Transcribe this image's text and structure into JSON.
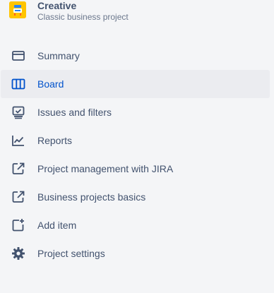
{
  "project": {
    "name": "Creative",
    "type": "Classic business project",
    "avatar_icon": "project-avatar-icon",
    "avatar_color": "#ffc400"
  },
  "nav": {
    "items": [
      {
        "label": "Summary",
        "icon": "summary-icon",
        "selected": false
      },
      {
        "label": "Board",
        "icon": "board-icon",
        "selected": true
      },
      {
        "label": "Issues and filters",
        "icon": "issues-icon",
        "selected": false
      },
      {
        "label": "Reports",
        "icon": "reports-icon",
        "selected": false
      },
      {
        "label": "Project management with JIRA",
        "icon": "external-link-icon",
        "selected": false
      },
      {
        "label": "Business projects basics",
        "icon": "external-link-icon",
        "selected": false
      },
      {
        "label": "Add item",
        "icon": "add-item-icon",
        "selected": false
      },
      {
        "label": "Project settings",
        "icon": "gear-icon",
        "selected": false
      }
    ]
  },
  "colors": {
    "background": "#f4f5f7",
    "selected_bg": "#ebecf0",
    "selected_text": "#0052cc",
    "text": "#42526e",
    "subtext": "#6b778c"
  }
}
